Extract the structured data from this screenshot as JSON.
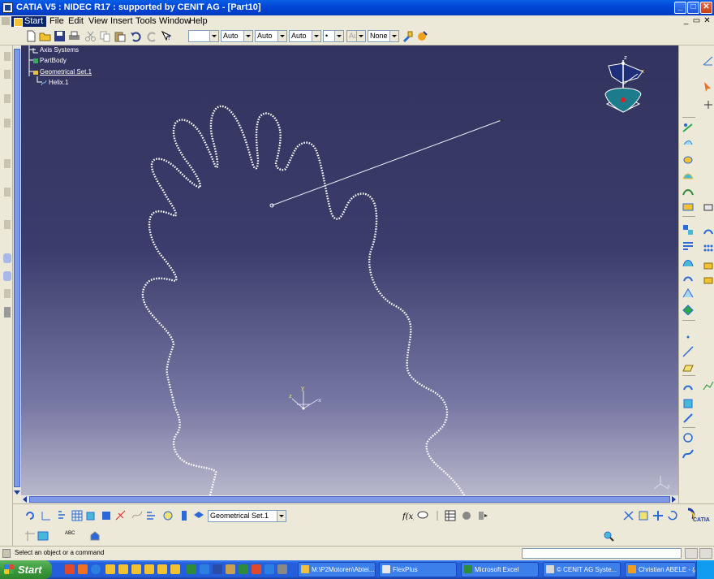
{
  "window": {
    "title": "CATIA V5 : NIDEC R17 : supported by CENIT AG - [Part10]"
  },
  "menu": {
    "items": [
      {
        "label": "Start"
      },
      {
        "label": "File"
      },
      {
        "label": "Edit"
      },
      {
        "label": "View"
      },
      {
        "label": "Insert"
      },
      {
        "label": "Tools"
      },
      {
        "label": "Window"
      },
      {
        "label": "Help"
      }
    ]
  },
  "toolbar": {
    "combos": [
      {
        "value": ""
      },
      {
        "value": "Auto"
      },
      {
        "value": "Auto"
      },
      {
        "value": "Auto"
      },
      {
        "value": "•"
      },
      {
        "value": "Aut"
      },
      {
        "value": "None"
      }
    ]
  },
  "tree": {
    "nodes": [
      {
        "label": "Axis Systems"
      },
      {
        "label": "PartBody"
      },
      {
        "label": "Geometrical Set.1"
      },
      {
        "label": "Helix.1"
      }
    ]
  },
  "compass": {
    "z": "z",
    "x": "x"
  },
  "triad": {
    "x": "x",
    "y": "y",
    "z": "z"
  },
  "mini_axis": {
    "label": "x"
  },
  "bottom": {
    "current_set": "Geometrical Set.1",
    "abc": "ABC"
  },
  "brand": {
    "name": "CATIA"
  },
  "status": {
    "message": "Select an object or a command"
  },
  "taskbar": {
    "start_label": "Start",
    "tasks": [
      {
        "label": "M:\\P2Motoren\\Abtei...",
        "color": "#F0C040"
      },
      {
        "label": "FlexPlus",
        "color": "#E8E8E8"
      },
      {
        "label": "Microsoft Excel",
        "color": "#2E8B3A"
      },
      {
        "label": "© CENIT AG Syste...",
        "color": "#D8D8D8"
      },
      {
        "label": "Christian ABELE - (A...",
        "color": "#F0A020"
      }
    ]
  },
  "colors": {
    "viewport_top": "#33335F",
    "viewport_bottom": "#B8B8CC",
    "helix": "#FFFFFF",
    "title_bar": "#0048D8"
  }
}
